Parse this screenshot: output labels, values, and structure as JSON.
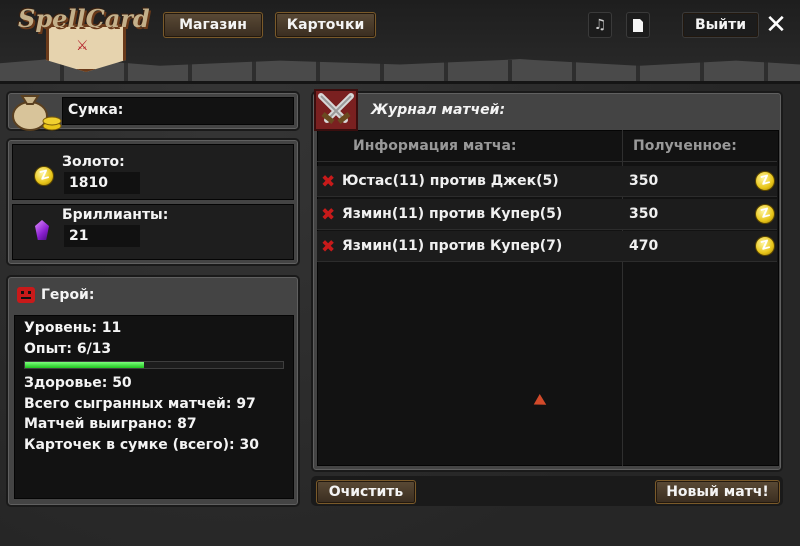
{
  "logo": {
    "text": "SpellCard"
  },
  "header": {
    "shop_label": "Магазин",
    "cards_label": "Карточки",
    "exit_label": "Выйти"
  },
  "bag": {
    "title": "Сумка:",
    "gold_label": "Золото:",
    "gold_value": "1810",
    "gems_label": "Бриллианты:",
    "gems_value": "21"
  },
  "hero": {
    "title": "Герой:",
    "level": "Уровень: 11",
    "xp": "Опыт: 6/13",
    "xp_progress": 0.46,
    "health": "Здоровье: 50",
    "total_matches": "Всего сыгранных матчей: 97",
    "matches_won": "Матчей выиграно: 87",
    "cards_in_bag": "Карточек в сумке (всего): 30"
  },
  "journal": {
    "title": "Журнал матчей:",
    "col_info": "Информация матча:",
    "col_reward": "Полученное:",
    "rows": [
      {
        "match": "Юстас(11) против Джек(5)",
        "reward": "350",
        "result": "loss"
      },
      {
        "match": "Язмин(11) против Купер(5)",
        "reward": "350",
        "result": "loss"
      },
      {
        "match": "Язмин(11) против Купер(7)",
        "reward": "470",
        "result": "loss"
      }
    ]
  },
  "footer": {
    "clear_label": "Очистить",
    "new_match_label": "Новый матч!"
  },
  "colors": {
    "accent_gold": "#e8c518",
    "loss_red": "#c81a1a",
    "xp_green": "#1ec41e",
    "button_brown": "#5a4a36"
  }
}
